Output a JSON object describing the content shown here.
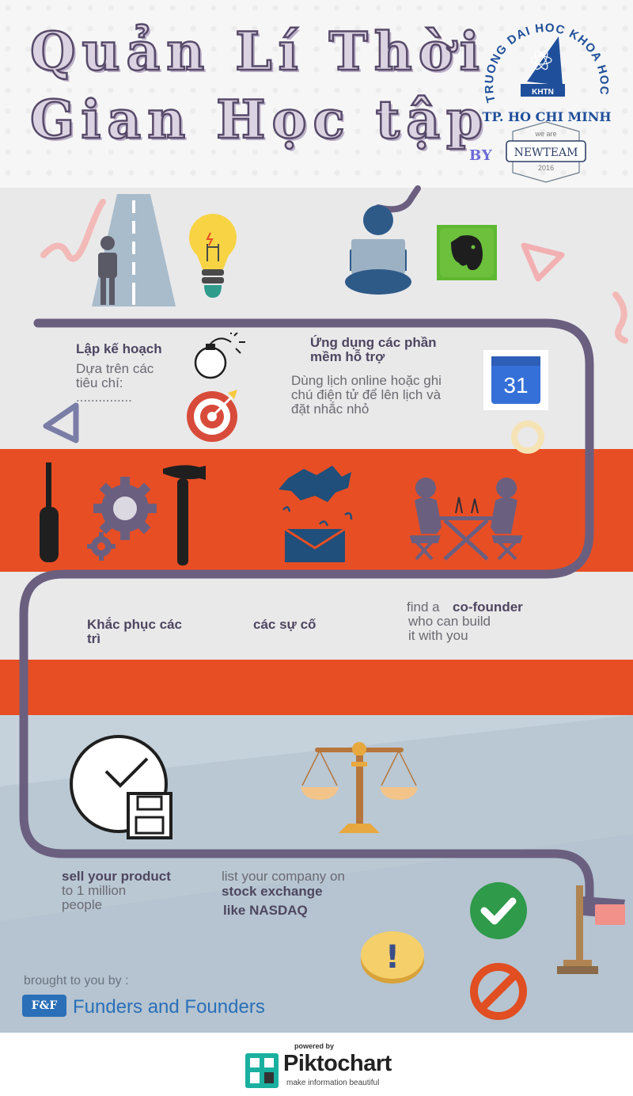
{
  "header": {
    "title_line1": "Quản Lí Thời",
    "title_line2": "Gian Học tập",
    "by_label": "BY",
    "badge_top": "we are",
    "badge_main": "NEWTEAM",
    "badge_year": "2016"
  },
  "logo": {
    "arc_text": "TRUONG DAI HOC KHOA HOC TU NHIEN",
    "inner": "KHTN",
    "city": "TP. HO CHI MINH"
  },
  "section1": {
    "plan_title": "Lập kế hoạch",
    "plan_desc_1": "Dựa trên các",
    "plan_desc_2": "tiêu chí:",
    "plan_desc_3": "...............",
    "app_title_1": "Ứng dụng các phần",
    "app_title_2": "mềm hỗ trợ",
    "app_desc_1": "Dùng lịch online hoặc ghi",
    "app_desc_2": "chú điện tử để lên lịch và",
    "app_desc_3": "đặt nhắc nhỏ",
    "calendar_number": "31"
  },
  "section2": {
    "fix_1": "Khắc phục các",
    "fix_2": "trì",
    "incidents": "các sự cố",
    "cofounder_pre": "find a",
    "cofounder_bold": "co-founder",
    "cofounder_2": "who can build",
    "cofounder_3": "it with you"
  },
  "section3": {
    "sell_bold": "sell your product",
    "sell_2": "to 1 million",
    "sell_3": "people",
    "list_1": "list your company on",
    "list_2": "stock exchange",
    "list_3": "like NASDAQ",
    "exclamation": "!"
  },
  "footer": {
    "brought": "brought to you by :",
    "ff_logo": "F&F",
    "ff_name": "Funders and Founders",
    "powered": "powered by",
    "pikto": "Piktochart",
    "pikto_tag": "make information beautiful"
  },
  "colors": {
    "orange": "#e84e24",
    "path": "#6b5f80",
    "gray_band": "#e9e9ea",
    "blue_band": "#c5d2dc"
  }
}
